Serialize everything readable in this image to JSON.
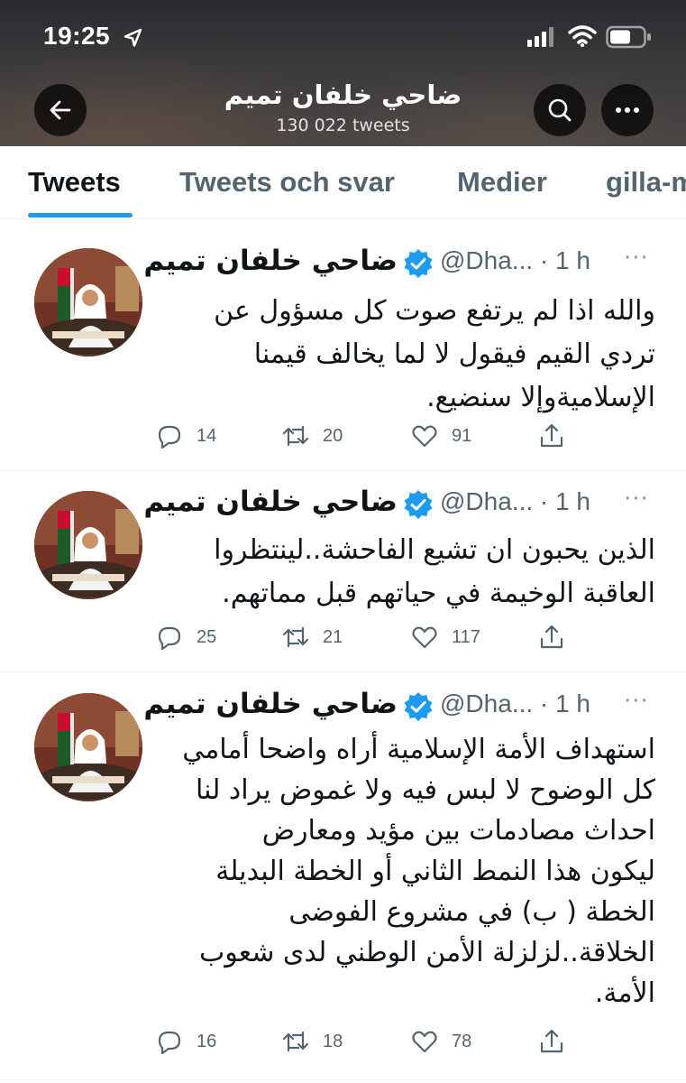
{
  "status_bar": {
    "time": "19:25"
  },
  "header": {
    "profile_name": "ضاحي خلفان تميم",
    "tweet_count": "130 022 tweets",
    "back_icon": "arrow-left-icon",
    "search_icon": "search-icon",
    "more_icon": "more-horizontal-icon"
  },
  "tabs": [
    {
      "label": "Tweets",
      "active": true
    },
    {
      "label": "Tweets och svar",
      "active": false
    },
    {
      "label": "Medier",
      "active": false
    },
    {
      "label": "gilla-m",
      "active": false
    }
  ],
  "colors": {
    "accent": "#1d9bf0",
    "secondary_text": "#536471",
    "primary_text": "#0f1419"
  },
  "tweets": [
    {
      "author": "ضاحي خلفان تميم",
      "handle_time": "@Dha... · 1 h",
      "lines": [
        "والله اذا لم يرتفع صوت كل مسؤول عن",
        "تردي القيم فيقول لا لما يخالف قيمنا",
        "الإسلاميةوإلا سنضيع."
      ],
      "replies": "14",
      "retweets": "20",
      "likes": "91"
    },
    {
      "author": "ضاحي خلفان تميم",
      "handle_time": "@Dha... · 1 h",
      "lines": [
        "الذين يحبون ان تشيع الفاحشة..لينتظروا",
        "العاقبة  الوخيمة في حياتهم قبل مماتهم."
      ],
      "replies": "25",
      "retweets": "21",
      "likes": "117"
    },
    {
      "author": "ضاحي خلفان تميم",
      "handle_time": "@Dha... · 1 h",
      "lines": [
        "استهداف الأمة الإسلامية أراه واضحا أمامي",
        "كل الوضوح لا لبس فيه ولا غموض يراد لنا",
        "احداث مصادمات بين مؤيد ومعارض",
        "ليكون هذا النمط الثاني أو الخطة البديلة",
        "الخطة ( ب) في مشروع الفوضى",
        "الخلاقة..لزلزلة الأمن الوطني لدى شعوب",
        "الأمة."
      ],
      "replies": "16",
      "retweets": "18",
      "likes": "78"
    }
  ]
}
